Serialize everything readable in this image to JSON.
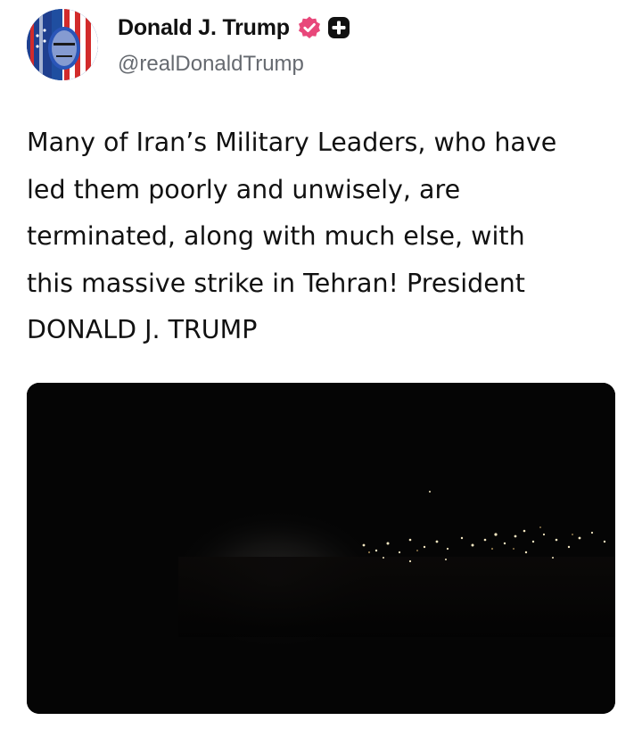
{
  "post": {
    "author": {
      "display_name": "Donald J. Trump",
      "handle": "@realDonaldTrump",
      "verified_icon": "verified-badge-icon",
      "plus_icon": "plus-icon",
      "verified_color": "#e8477a"
    },
    "text": "Many of Iran’s Military Leaders, who have\nled them poorly and unwisely, are\nterminated, along with much else, with\nthis massive strike in Tehran! President\nDONALD J. TRUMP",
    "media": {
      "type": "video",
      "background_color": "#050505"
    }
  }
}
